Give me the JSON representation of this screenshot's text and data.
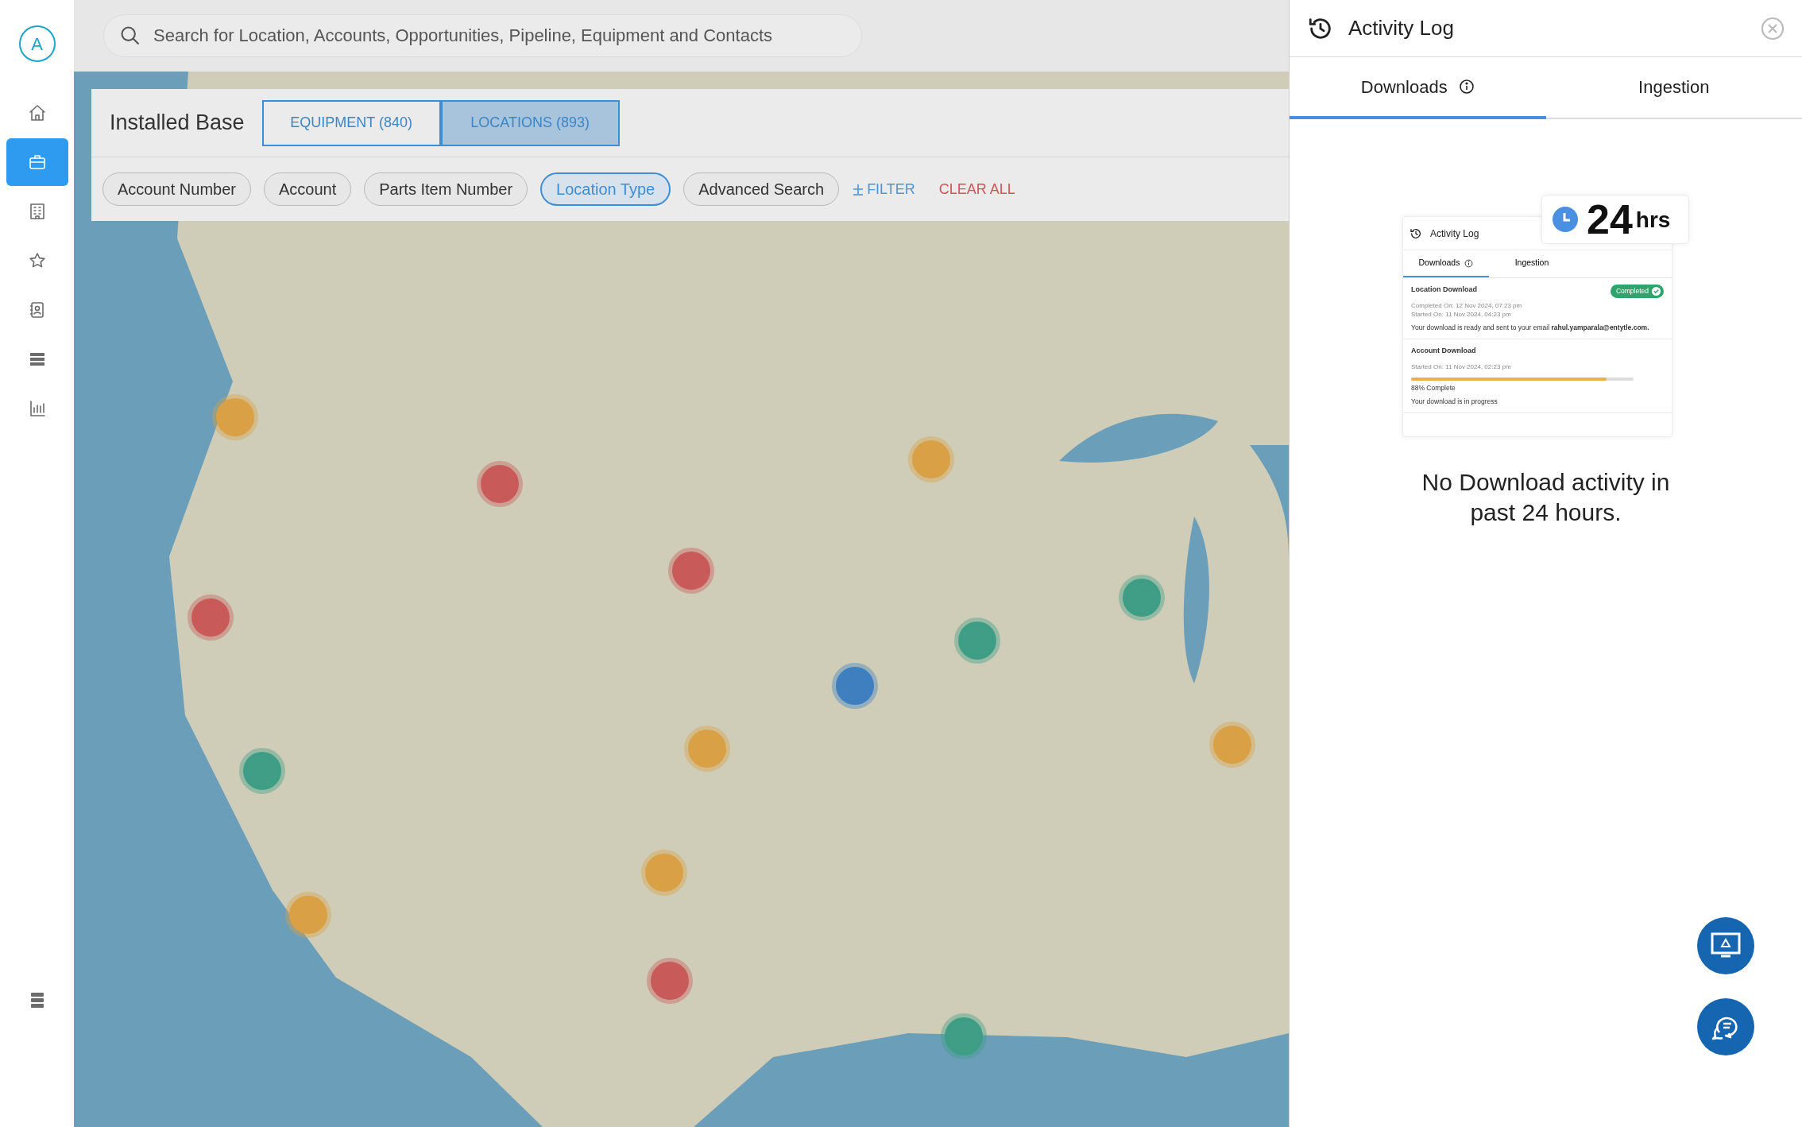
{
  "sidebar": {
    "avatar": "A",
    "items": [
      {
        "kind": "home",
        "selected": false
      },
      {
        "kind": "briefcase",
        "selected": true
      },
      {
        "kind": "building",
        "selected": false
      },
      {
        "kind": "star",
        "selected": false
      },
      {
        "kind": "contacts",
        "selected": false
      },
      {
        "kind": "list",
        "selected": false
      },
      {
        "kind": "chart",
        "selected": false
      }
    ],
    "bottom_item": {
      "kind": "layers",
      "selected": false
    }
  },
  "search": {
    "placeholder": "Search for Location, Accounts, Opportunities, Pipeline, Equipment and Contacts"
  },
  "installed_base": {
    "title": "Installed Base",
    "tabs": [
      {
        "label": "EQUIPMENT (840)",
        "selected": false
      },
      {
        "label": "LOCATIONS (893)",
        "selected": true
      }
    ],
    "filters": [
      {
        "label": "Account Number",
        "selected": false
      },
      {
        "label": "Account",
        "selected": false
      },
      {
        "label": "Parts Item Number",
        "selected": false
      },
      {
        "label": "Location Type",
        "selected": true
      },
      {
        "label": "Advanced Search",
        "selected": false
      }
    ],
    "add_filter": "FILTER",
    "clear_all": "CLEAR ALL"
  },
  "activity_log": {
    "title": "Activity Log",
    "tabs": [
      {
        "label": "Downloads",
        "info": true,
        "selected": true
      },
      {
        "label": "Ingestion",
        "info": false,
        "selected": false
      }
    ],
    "illustration": {
      "title": "Activity Log",
      "badge_number": "24",
      "badge_unit": "hrs",
      "tabs": [
        {
          "label": "Downloads",
          "info": true,
          "selected": true
        },
        {
          "label": "Ingestion",
          "info": false,
          "selected": false
        }
      ],
      "entries": [
        {
          "kind": "completed",
          "title": "Location Download",
          "status": "Completed",
          "lines": [
            "Completed On: 12 Nov 2024, 07:23 pm",
            "Started On: 11 Nov 2024, 04:23 pm"
          ],
          "message": "Your download is ready and sent to your email **rahul.yamparala@entytle.com.**"
        },
        {
          "kind": "in-progress",
          "title": "Account Download",
          "lines": [
            "Started On: 11 Nov 2024, 02:23 pm"
          ],
          "level": 0.88,
          "progress_label": "88% Complete",
          "message": "Your download is in progress"
        }
      ]
    },
    "empty_message": "No Download activity in past 24 hours."
  },
  "floating_buttons": [
    {
      "kind": "alert-monitor"
    },
    {
      "kind": "chat"
    }
  ]
}
